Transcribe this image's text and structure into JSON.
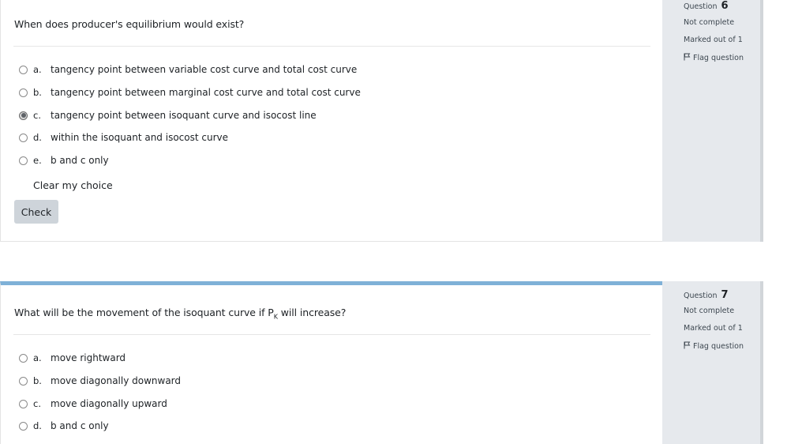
{
  "questions": [
    {
      "info": {
        "question_label": "Question",
        "number": "6",
        "status": "Not complete",
        "marked": "Marked out of 1",
        "flag": "Flag question"
      },
      "text": "When does producer's equilibrium would exist?",
      "answers": [
        {
          "letter": "a.",
          "text": "tangency point between variable cost curve and total cost curve",
          "checked": false
        },
        {
          "letter": "b.",
          "text": "tangency point between marginal cost curve and total cost curve",
          "checked": false
        },
        {
          "letter": "c.",
          "text": "tangency point between isoquant curve and isocost line",
          "checked": true
        },
        {
          "letter": "d.",
          "text": "within the isoquant and isocost curve",
          "checked": false
        },
        {
          "letter": "e.",
          "text": "b and c only",
          "checked": false
        }
      ],
      "clear_label": "Clear my choice",
      "check_label": "Check"
    },
    {
      "info": {
        "question_label": "Question",
        "number": "7",
        "status": "Not complete",
        "marked": "Marked out of 1",
        "flag": "Flag question"
      },
      "text_before": "What will be the movement of the isoquant curve if P",
      "text_sub": "K",
      "text_after": " will increase?",
      "answers": [
        {
          "letter": "a.",
          "text": "move rightward",
          "checked": false
        },
        {
          "letter": "b.",
          "text": "move diagonally downward",
          "checked": false
        },
        {
          "letter": "c.",
          "text": "move diagonally upward",
          "checked": false
        },
        {
          "letter": "d.",
          "text": "b and c only",
          "checked": false
        }
      ]
    }
  ],
  "colors": {
    "info_panel": "#e6e9ed",
    "accent_border": "#7fb1d7",
    "check_button": "#ced4da"
  }
}
